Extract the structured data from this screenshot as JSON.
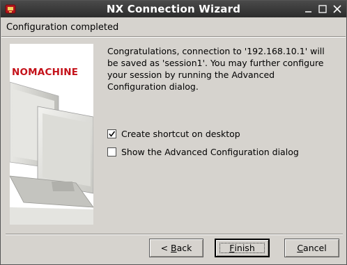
{
  "window": {
    "title": "NX Connection Wizard"
  },
  "header": {
    "title": "Configuration completed"
  },
  "banner": {
    "brand": "NOMACHINE"
  },
  "message": {
    "text": "Congratulations, connection to '192.168.10.1' will be saved as 'session1'. You may further configure your session by running the Advanced Configuration dialog."
  },
  "options": [
    {
      "label": "Create shortcut on desktop",
      "checked": true
    },
    {
      "label": "Show the Advanced Configuration dialog",
      "checked": false
    }
  ],
  "buttons": {
    "back_mnemonic": "B",
    "back_rest": "ack",
    "back_prefix": "< ",
    "finish_mnemonic": "F",
    "finish_rest": "inish",
    "cancel_mnemonic": "C",
    "cancel_rest": "ancel"
  },
  "colors": {
    "brand": "#c4121a",
    "titlebar": "#2c2c2c",
    "dialog_bg": "#d6d3ce"
  },
  "icons": {
    "app": "nx-app-icon",
    "minimize": "minimize-icon",
    "maximize": "maximize-icon",
    "close": "close-icon",
    "check": "checkmark-icon"
  }
}
